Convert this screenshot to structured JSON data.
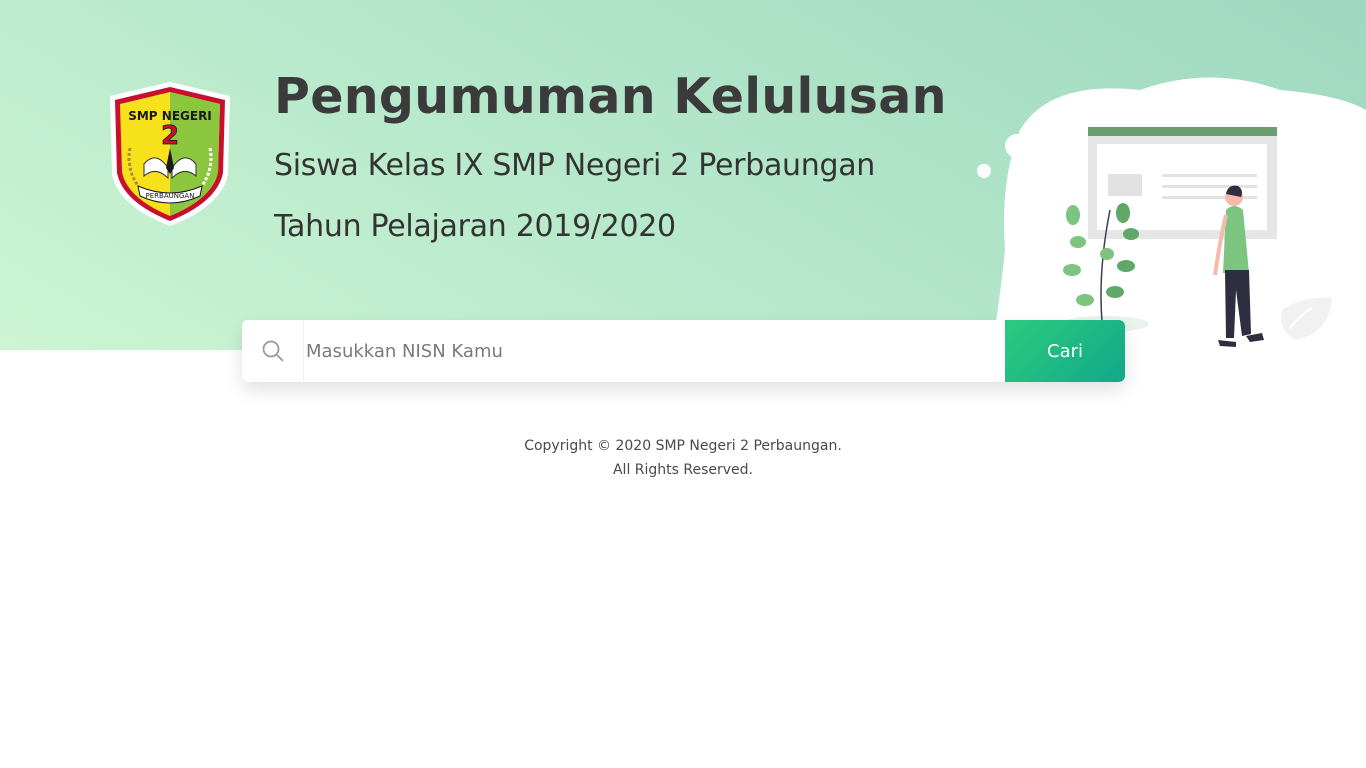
{
  "header": {
    "title": "Pengumuman Kelulusan",
    "subtitle_line1": "Siswa Kelas IX SMP Negeri 2 Perbaungan",
    "subtitle_line2": "Tahun Pelajaran 2019/2020"
  },
  "logo": {
    "top_text": "SMP NEGERI",
    "number": "2",
    "ribbon_text": "PERBAUNGAN",
    "colors": {
      "outer": "#c8102e",
      "left": "#f7e11b",
      "right": "#8cc63f"
    }
  },
  "search": {
    "icon": "search-icon",
    "placeholder": "Masukkan NISN Kamu",
    "value": "",
    "button_label": "Cari"
  },
  "footer": {
    "line1": "Copyright © 2020 SMP Negeri 2 Perbaungan.",
    "line2": "All Rights Reserved."
  },
  "colors": {
    "accent": "#1fb985",
    "hero_bg": "#b6e8cb",
    "title_text": "#3b3b3b"
  }
}
